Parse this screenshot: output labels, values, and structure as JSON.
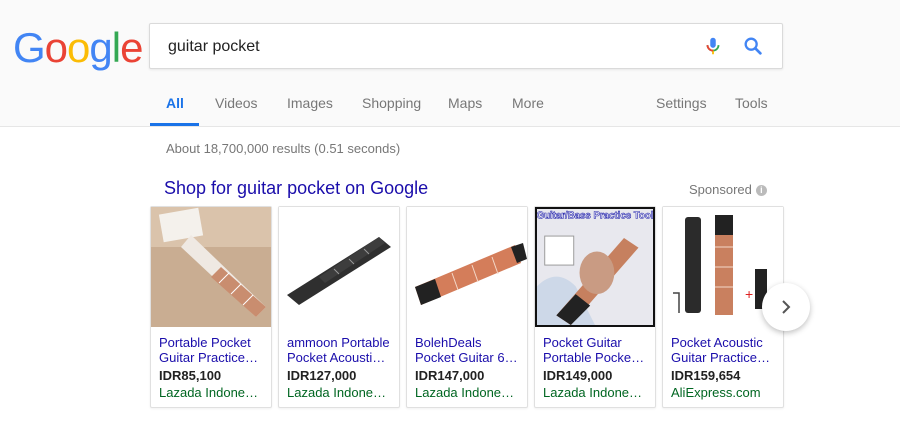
{
  "logo": {
    "letters": [
      "G",
      "o",
      "o",
      "g",
      "l",
      "e"
    ],
    "colors": [
      "#4285f4",
      "#ea4335",
      "#fbbc05",
      "#4285f4",
      "#34a853",
      "#ea4335"
    ]
  },
  "search": {
    "query": "guitar pocket"
  },
  "tabs": [
    {
      "label": "All",
      "active": true
    },
    {
      "label": "Videos"
    },
    {
      "label": "Images"
    },
    {
      "label": "Shopping"
    },
    {
      "label": "Maps"
    },
    {
      "label": "More"
    },
    {
      "label": "Settings"
    },
    {
      "label": "Tools"
    }
  ],
  "stats": "About 18,700,000 results (0.51 seconds)",
  "shopping": {
    "title": "Shop for guitar pocket on Google",
    "sponsored": "Sponsored",
    "info_icon": "i",
    "products": [
      {
        "title_line1": "Portable Pocket",
        "title_line2": "Guitar Practice…",
        "price": "IDR85,100",
        "store": "Lazada Indone…"
      },
      {
        "title_line1": "ammoon Portable",
        "title_line2": "Pocket Acousti…",
        "price": "IDR127,000",
        "store": "Lazada Indone…"
      },
      {
        "title_line1": "BolehDeals",
        "title_line2": "Pocket Guitar 6…",
        "price": "IDR147,000",
        "store": "Lazada Indone…"
      },
      {
        "title_line1": "Pocket Guitar",
        "title_line2": "Portable Pocke…",
        "price": "IDR149,000",
        "store": "Lazada Indone…",
        "image_text": "Guitar/Bass Practice Tool"
      },
      {
        "title_line1": "Pocket Acoustic",
        "title_line2": "Guitar Practice…",
        "price": "IDR159,654",
        "store": "AliExpress.com"
      }
    ]
  },
  "icons": {
    "mic": "microphone-icon",
    "search": "search-icon",
    "next": "chevron-right-icon"
  },
  "colors": {
    "link": "#1a0dab",
    "store": "#006621",
    "active_tab": "#1a73e8"
  }
}
